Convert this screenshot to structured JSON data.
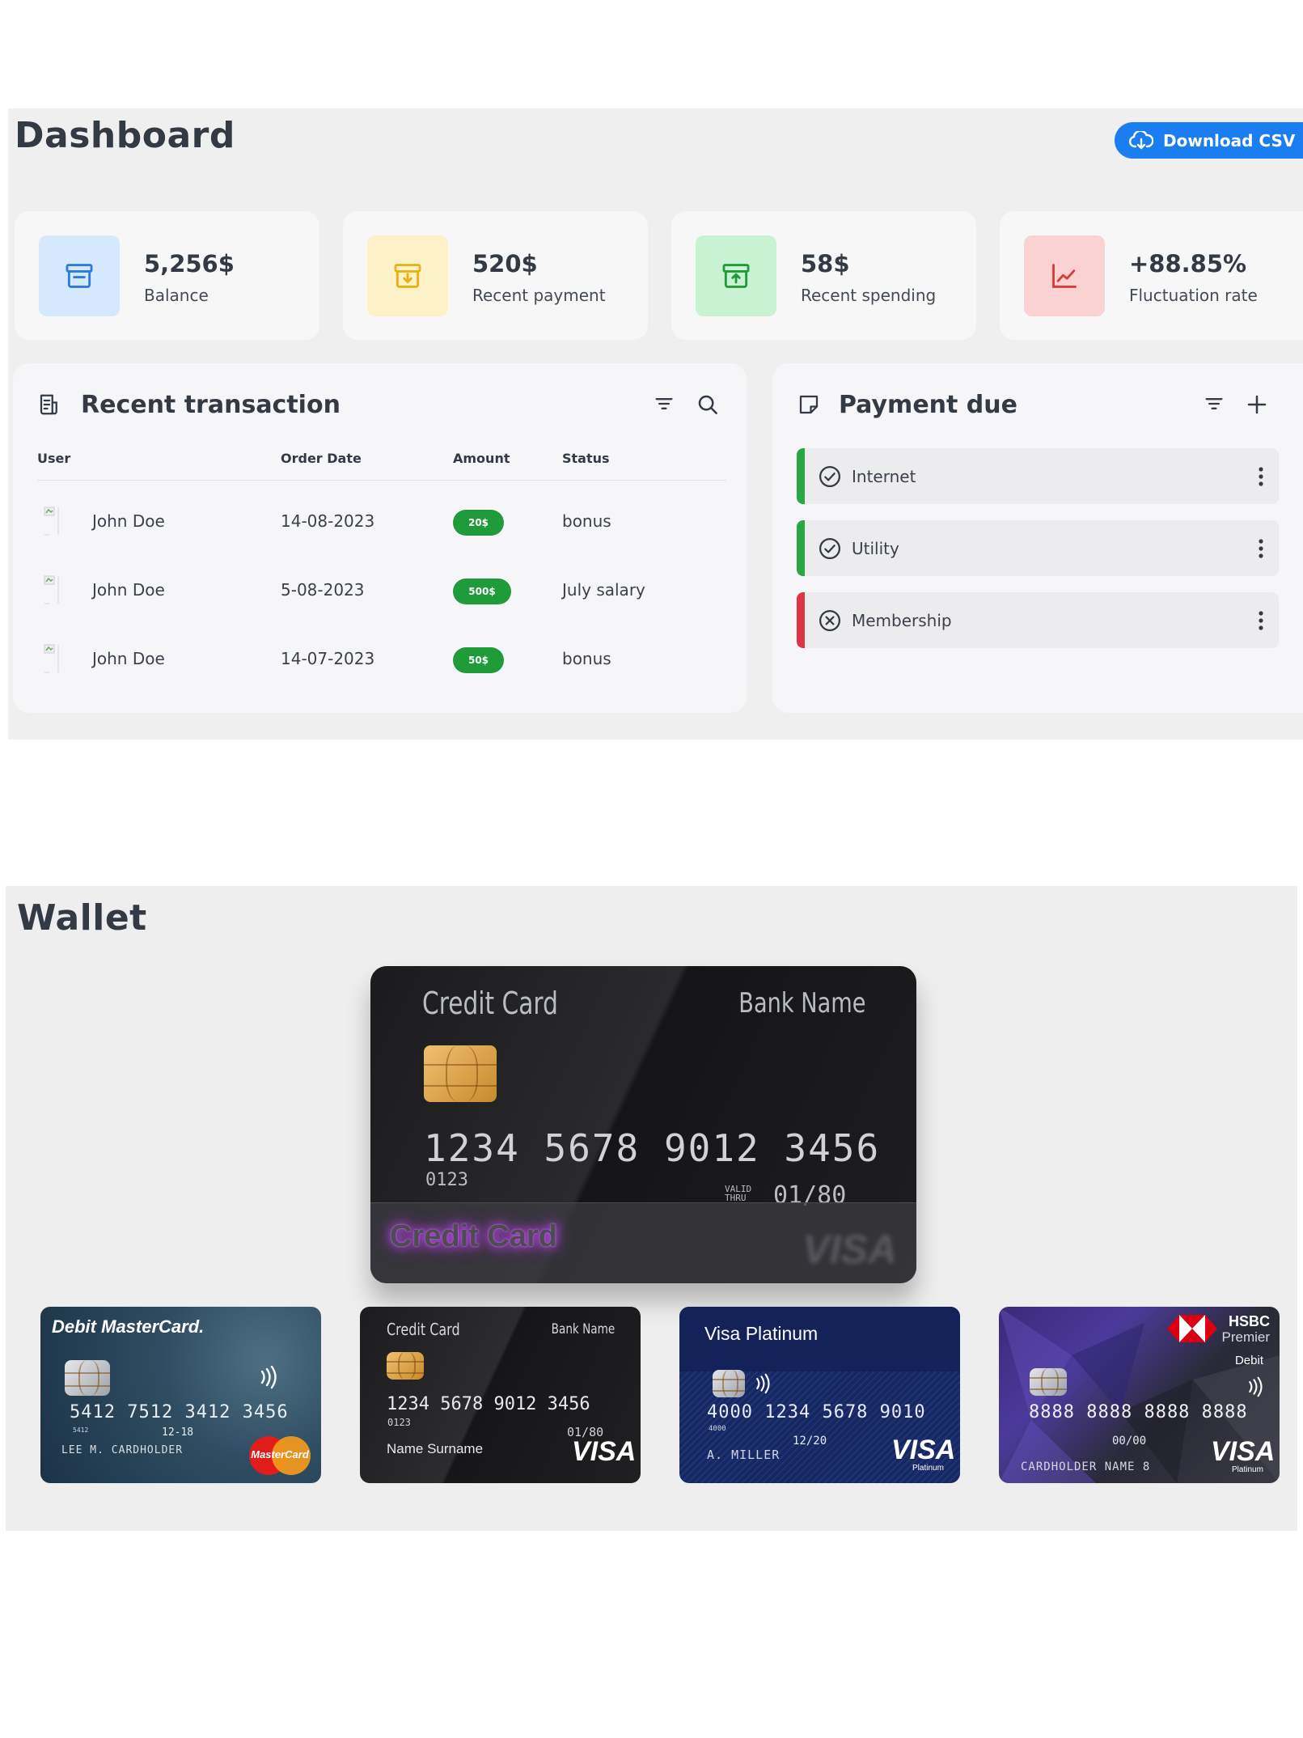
{
  "dashboard": {
    "title": "Dashboard",
    "download_button": "Download CSV",
    "stats": [
      {
        "value": "5,256$",
        "label": "Balance",
        "icon": "archive-icon",
        "color": "#2d7be0",
        "bg": "#d6e8fb"
      },
      {
        "value": "520$",
        "label": "Recent payment",
        "icon": "archive-download-icon",
        "color": "#e8b215",
        "bg": "#fdf1c7"
      },
      {
        "value": "58$",
        "label": "Recent spending",
        "icon": "archive-upload-icon",
        "color": "#1f9b3a",
        "bg": "#c9f2d2"
      },
      {
        "value": "+88.85%",
        "label": "Fluctuation rate",
        "icon": "line-chart-icon",
        "color": "#d93b3b",
        "bg": "#fbd2d2"
      }
    ],
    "transactions": {
      "title": "Recent transaction",
      "columns": [
        "User",
        "Order Date",
        "Amount",
        "Status"
      ],
      "rows": [
        {
          "user": "John Doe",
          "date": "14-08-2023",
          "amount": "20$",
          "status": "bonus"
        },
        {
          "user": "John Doe",
          "date": "5-08-2023",
          "amount": "500$",
          "status": "July salary"
        },
        {
          "user": "John Doe",
          "date": "14-07-2023",
          "amount": "50$",
          "status": "bonus"
        }
      ]
    },
    "payment_due": {
      "title": "Payment due",
      "items": [
        {
          "label": "Internet",
          "state": "paid",
          "color": "#28a745"
        },
        {
          "label": "Utility",
          "state": "paid",
          "color": "#28a745"
        },
        {
          "label": "Membership",
          "state": "unpaid",
          "color": "#dc3545"
        }
      ]
    }
  },
  "wallet": {
    "title": "Wallet",
    "featured": {
      "type_label": "Credit Card",
      "bank_label": "Bank Name",
      "number": "1234 5678 9012 3456",
      "sub_number": "0123",
      "valid_label": "VALID THRU",
      "expiry": "01/80",
      "overlay_label": "Credit Card",
      "network": "VISA"
    },
    "cards": [
      {
        "title": "Debit MasterCard.",
        "number": "5412 7512 3412 3456",
        "small": "5412",
        "valid": "12-18",
        "holder": "LEE M. CARDHOLDER",
        "network": "MasterCard"
      },
      {
        "title": "Credit Card",
        "bank": "Bank Name",
        "number": "1234 5678 9012 3456",
        "small": "0123",
        "valid": "01/80",
        "holder": "Name Surname",
        "network": "VISA"
      },
      {
        "title": "Visa Platinum",
        "number": "4000 1234 5678 9010",
        "small": "4000",
        "valid": "12/20",
        "holder": "A. MILLER",
        "network": "VISA",
        "network_sub": "Platinum"
      },
      {
        "title": "HSBC",
        "title_sub": "Premier",
        "tier": "Debit",
        "number": "8888 8888 8888 8888",
        "valid": "00/00",
        "holder": "CARDHOLDER NAME",
        "holder_suffix": "8",
        "network": "VISA",
        "network_sub": "Platinum"
      }
    ]
  }
}
